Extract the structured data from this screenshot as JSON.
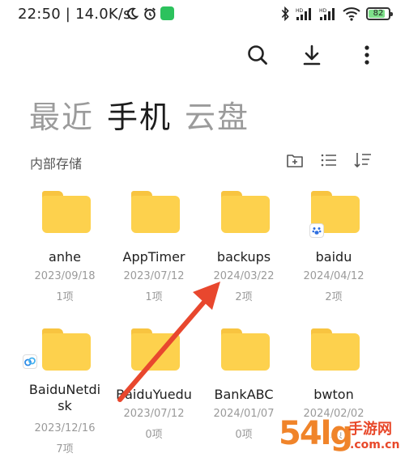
{
  "status_bar": {
    "time": "22:50",
    "speed": "14.0K/s",
    "battery": "82",
    "battery_level_percent": 82,
    "icons": [
      "moon-icon",
      "alarm-icon",
      "wechat-icon",
      "bluetooth-icon",
      "signal-hd-icon",
      "signal-hd-icon",
      "wifi-icon",
      "battery-icon"
    ]
  },
  "toolbar": {
    "icons": [
      "search-icon",
      "download-icon",
      "more-vertical-icon"
    ]
  },
  "tabs": [
    {
      "label": "最近",
      "active": false
    },
    {
      "label": "手机",
      "active": true
    },
    {
      "label": "云盘",
      "active": false
    }
  ],
  "section": {
    "title": "内部存储",
    "tools": [
      "new-folder-icon",
      "list-view-icon",
      "sort-icon"
    ]
  },
  "folders": [
    {
      "name": "anhe",
      "date": "2023/09/18",
      "count": "1项",
      "badge": ""
    },
    {
      "name": "AppTimer",
      "date": "2023/07/12",
      "count": "1项",
      "badge": ""
    },
    {
      "name": "backups",
      "date": "2024/03/22",
      "count": "2项",
      "badge": ""
    },
    {
      "name": "baidu",
      "date": "2024/04/12",
      "count": "2项",
      "badge": "baidu-paw-icon"
    },
    {
      "name": "BaiduNetdisk",
      "name_line1": "BaiduNetdi",
      "name_line2": "sk",
      "date": "2023/12/16",
      "count": "7项",
      "badge": "baidu-netdisk-icon"
    },
    {
      "name": "BaiduYuedu",
      "date": "2023/07/12",
      "count": "0项",
      "badge": ""
    },
    {
      "name": "BankABC",
      "date": "2024/01/07",
      "count": "0项",
      "badge": ""
    },
    {
      "name": "bwton",
      "date": "2024/02/02",
      "count": "1项",
      "badge": ""
    }
  ],
  "annotation": {
    "color": "#e8472e"
  },
  "watermark": {
    "big": "54lg",
    "small_top": "手游网",
    "small_bottom": ".com.cn"
  },
  "colors": {
    "folder": "#fdd14d",
    "folder_tab": "#f8c440",
    "active_tab": "#1c1c1c",
    "inactive_tab": "#9b9b9b",
    "meta_text": "#9a9a9a"
  }
}
